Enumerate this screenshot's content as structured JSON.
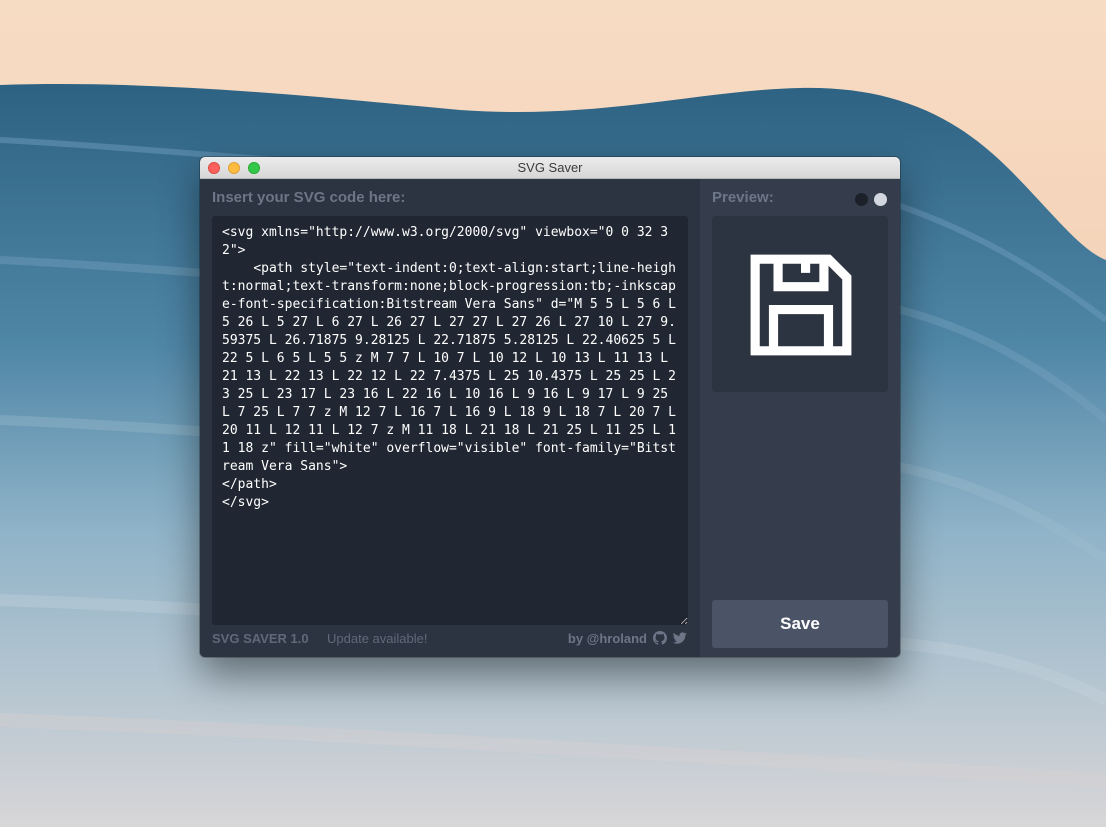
{
  "window": {
    "title": "SVG Saver"
  },
  "editor": {
    "label": "Insert your SVG code here:",
    "code": "<svg xmlns=\"http://www.w3.org/2000/svg\" viewbox=\"0 0 32 32\">\n    <path style=\"text-indent:0;text-align:start;line-height:normal;text-transform:none;block-progression:tb;-inkscape-font-specification:Bitstream Vera Sans\" d=\"M 5 5 L 5 6 L 5 26 L 5 27 L 6 27 L 26 27 L 27 27 L 27 26 L 27 10 L 27 9.59375 L 26.71875 9.28125 L 22.71875 5.28125 L 22.40625 5 L 22 5 L 6 5 L 5 5 z M 7 7 L 10 7 L 10 12 L 10 13 L 11 13 L 21 13 L 22 13 L 22 12 L 22 7.4375 L 25 10.4375 L 25 25 L 23 25 L 23 17 L 23 16 L 22 16 L 10 16 L 9 16 L 9 17 L 9 25 L 7 25 L 7 7 z M 12 7 L 16 7 L 16 9 L 18 9 L 18 7 L 20 7 L 20 11 L 12 11 L 12 7 z M 11 18 L 21 18 L 21 25 L 11 25 L 11 18 z\" fill=\"white\" overflow=\"visible\" font-family=\"Bitstream Vera Sans\">\n</path>\n</svg>"
  },
  "preview": {
    "label": "Preview:",
    "icon": "floppy-disk-icon",
    "themes": [
      "dark",
      "light"
    ]
  },
  "footer": {
    "version": "SVG SAVER 1.0",
    "update": "Update available!",
    "by": "by @hroland",
    "icons": [
      "github-icon",
      "twitter-icon"
    ]
  },
  "actions": {
    "save_label": "Save"
  },
  "colors": {
    "left_pane": "#2d3441",
    "right_pane": "#353d4c",
    "code_bg": "#212732",
    "button_bg": "#4b5466",
    "muted_text": "#6c7687"
  }
}
